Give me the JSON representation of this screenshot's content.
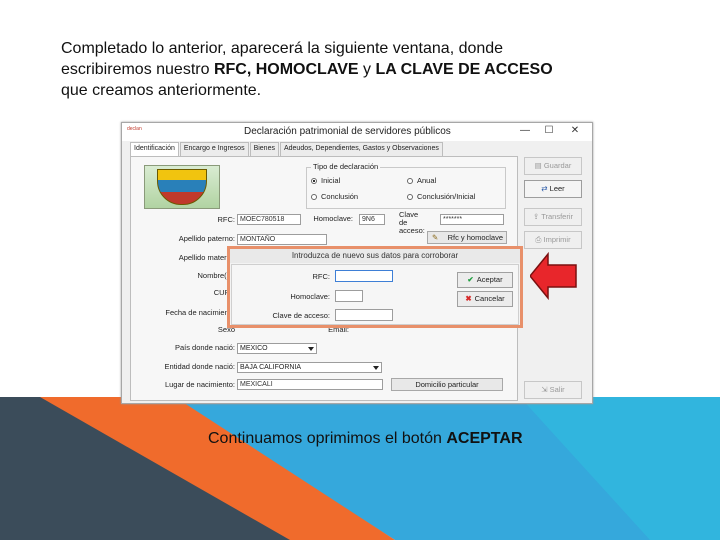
{
  "slide": {
    "intro_1": "Completado lo anterior, aparecerá la siguiente ventana, donde escribiremos nuestro ",
    "intro_bold_1": "RFC, HOMOCLAVE",
    "intro_2": " y ",
    "intro_bold_2": "LA CLAVE DE ACCESO",
    "intro_3": " que creamos anteriormente.",
    "caption_1": "Continuamos oprimimos el botón ",
    "caption_bold": "ACEPTAR"
  },
  "window": {
    "title": "Declaración patrimonial de servidores públicos",
    "app_icon_text": "declan",
    "minimize": "—",
    "maximize": "☐",
    "close": "✕",
    "tabs": [
      "Identificación",
      "Encargo e Ingresos",
      "Bienes",
      "Adeudos, Dependientes, Gastos y Observaciones"
    ]
  },
  "form": {
    "tipo_title": "Tipo de declaración",
    "radio_inicial": "Inicial",
    "radio_anual": "Anual",
    "radio_conclusion": "Conclusión",
    "radio_conclusion_inicial": "Conclusión/Inicial",
    "rfc_label": "RFC:",
    "rfc_value": "MOEC780518",
    "homoclave_label": "Homoclave:",
    "homoclave_value": "9N6",
    "clave_label": "Clave de acceso:",
    "clave_value": "*******",
    "rfc_homoclave_button": "Rfc y homoclave",
    "apellido_paterno_label": "Apellido paterno:",
    "apellido_paterno_value": "MONTAÑO",
    "apellido_materno_label": "Apellido materno",
    "nombres_label": "Nombre(s):",
    "curp_label": "CURP",
    "fecha_label": "Fecha de nacimiento",
    "sexo_label": "Sexo",
    "email_label": "Email:",
    "pais_label": "País donde nació:",
    "pais_value": "MEXICO",
    "entidad_label": "Entidad donde nació:",
    "entidad_value": "BAJA CALIFORNIA",
    "lugar_label": "Lugar de nacimiento:",
    "lugar_value": "MEXICALI",
    "domicilio_button": "Domicilio particular"
  },
  "side_buttons": {
    "guardar": "Guardar",
    "leer": "Leer",
    "transferir": "Transferir",
    "imprimir": "Imprimir",
    "salir": "Salir"
  },
  "dialog": {
    "title": "Introduzca de nuevo sus datos para corroborar",
    "rfc_label": "RFC:",
    "homoclave_label": "Homoclave:",
    "clave_label": "Clave de acceso:",
    "aceptar": "Aceptar",
    "cancelar": "Cancelar"
  },
  "colors": {
    "dialog_border": "#e8906a",
    "arrow_red": "#e8262b",
    "bg_blue": "#35a8dc",
    "bg_orange": "#f06b2c",
    "bg_dark": "#3b4c5a"
  }
}
